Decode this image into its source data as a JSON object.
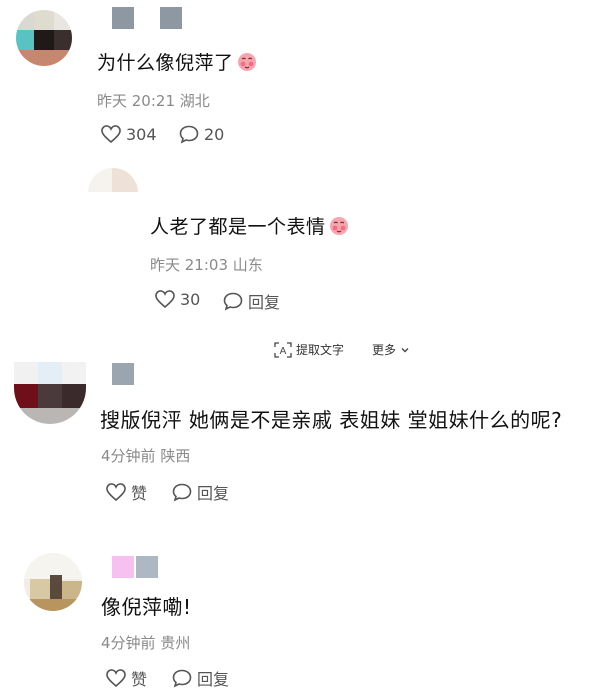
{
  "comments": [
    {
      "text": "为什么像倪萍了",
      "time": "昨天 20:21",
      "location": "湖北",
      "likes": "304",
      "replies": "20"
    },
    {
      "text": "人老了都是一个表情",
      "time": "昨天 21:03",
      "location": "山东",
      "likes": "30",
      "reply_label": "回复"
    },
    {
      "text": "搜版倪泙 她俩是不是亲戚 表姐妹 堂姐妹什么的呢?",
      "time": "4分钟前",
      "location": "陕西",
      "like_label": "赞",
      "reply_label": "回复"
    },
    {
      "text": "像倪萍嘞!",
      "time": "4分钟前",
      "location": "贵州",
      "like_label": "赞",
      "reply_label": "回复"
    }
  ],
  "toolbar": {
    "extract_text": "提取文字",
    "more": "更多"
  },
  "colors": {
    "meta": "#8a8a8a",
    "emoji": "#f07a8c"
  }
}
